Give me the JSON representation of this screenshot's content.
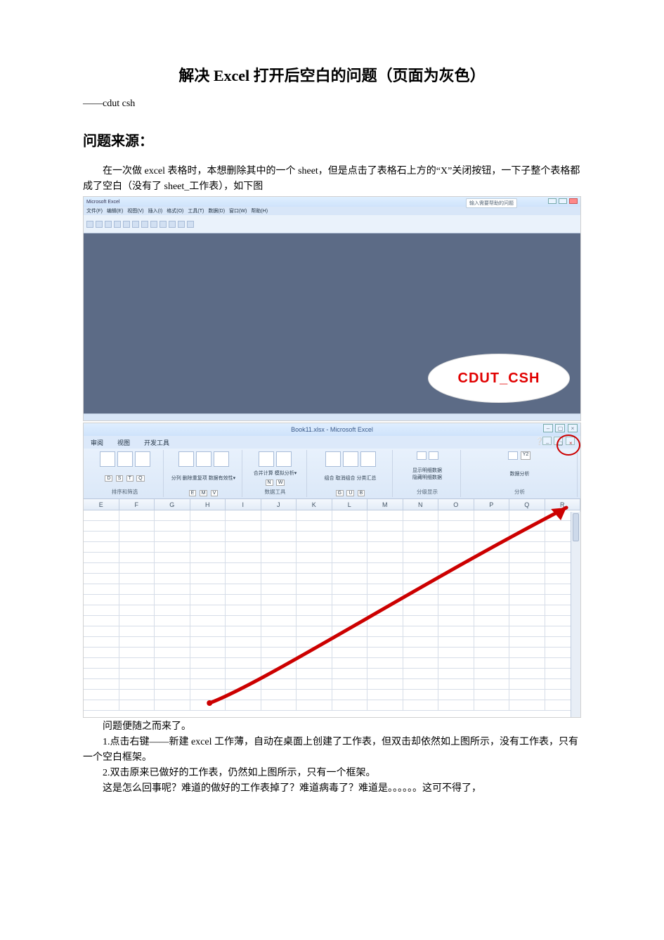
{
  "title": "解决 Excel 打开后空白的问题（页面为灰色）",
  "author": "——cdut csh",
  "section1_heading": "问题来源：",
  "para1": "在一次做 excel 表格时，本想删除其中的一个 sheet，但是点击了表格石上方的“X”关闭按钮，一下子整个表格都成了空白（没有了 sheet_工作表），如下图",
  "fig1": {
    "app_name": "Microsoft Excel",
    "search_placeholder": "输入需要帮助的问题",
    "menus": [
      "文件(F)",
      "编辑(E)",
      "视图(V)",
      "插入(I)",
      "格式(O)",
      "工具(T)",
      "数据(D)",
      "窗口(W)",
      "帮助(H)"
    ],
    "watermark": "CDUT_CSH"
  },
  "fig2": {
    "window_title": "Book11.xlsx - Microsoft Excel",
    "tabs": [
      "审阅",
      "视图",
      "开发工具"
    ],
    "help_icon": "❔",
    "ribbon_groups": [
      {
        "label": "排序和筛选",
        "keys": [
          "D",
          "S",
          "T",
          "Q"
        ]
      },
      {
        "label": "",
        "big": [
          "分列",
          "删除重复项",
          "数据有效性▾"
        ],
        "keys": [
          "E",
          "M",
          "V"
        ]
      },
      {
        "label": "数据工具",
        "big": [
          "合并计算",
          "模拟分析▾"
        ],
        "keys": [
          "N",
          "W"
        ]
      },
      {
        "label": "",
        "big": [
          "组合",
          "取消组合",
          "分类汇总"
        ],
        "keys": [
          "G",
          "U",
          "B"
        ]
      },
      {
        "label": "分级显示",
        "big": [
          "显示明细数据",
          "隐藏明细数据"
        ],
        "keys": [
          "Y2"
        ]
      },
      {
        "label": "分析",
        "big": [
          "数据分析"
        ]
      }
    ],
    "columns": [
      "E",
      "F",
      "G",
      "H",
      "I",
      "J",
      "K",
      "L",
      "M",
      "N",
      "O",
      "P",
      "Q",
      "R"
    ]
  },
  "follow": {
    "l1": "问题便随之而来了。",
    "l2": "1.点击右键——新建 excel 工作薄，自动在桌面上创建了工作表，但双击却依然如上图所示，没有工作表，只有一个空白框架。",
    "l3": "2.双击原来已做好的工作表，仍然如上图所示，只有一个框架。",
    "l4": "这是怎么回事呢？难道的做好的工作表掉了？难道病毒了？难道是。。。。。。这可不得了，"
  }
}
